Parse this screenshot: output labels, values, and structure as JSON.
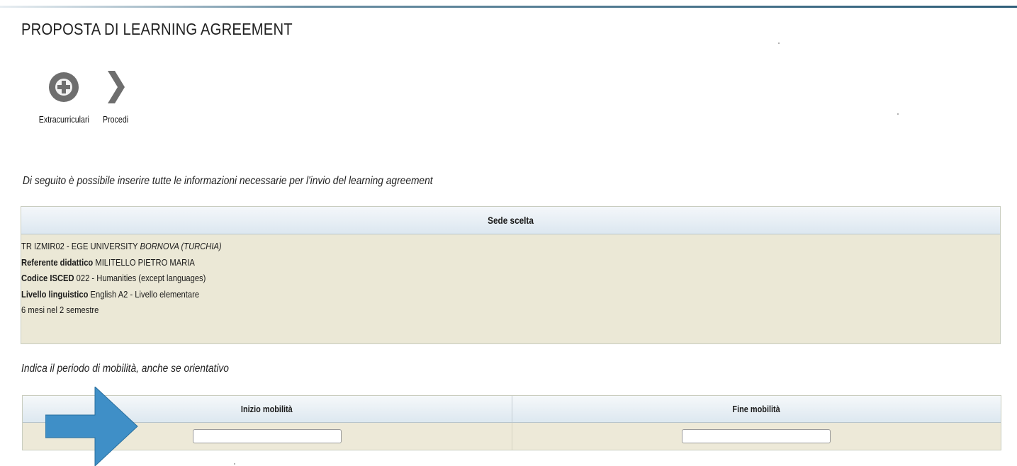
{
  "page": {
    "title": "PROPOSTA DI LEARNING AGREEMENT"
  },
  "toolbar": {
    "extracurricular_label": "Extracurriculari",
    "procedi_label": "Procedi"
  },
  "instructions": {
    "main": "Di seguito è possibile inserire tutte le informazioni necessarie per l'invio del learning agreement",
    "period": "Indica il periodo di mobilità, anche se orientativo"
  },
  "sede": {
    "header": "Sede scelta",
    "code_name": "TR IZMIR02 - EGE UNIVERSITY",
    "city_country": "BORNOVA (TURCHIA)",
    "referente_label": "Referente didattico",
    "referente_value": "MILITELLO PIETRO MARIA",
    "isced_label": "Codice ISCED",
    "isced_value": "022 - Humanities (except languages)",
    "livello_label": "Livello linguistico",
    "livello_value": "English A2 - Livello elementare",
    "durata": "6 mesi nel 2 semestre"
  },
  "mobility": {
    "start_header": "Inizio mobilità",
    "end_header": "Fine mobilità",
    "start_value": "",
    "end_value": ""
  },
  "colors": {
    "header_gradient_top": "#f4f7fa",
    "header_gradient_bottom": "#dce7f0",
    "row_background": "#ebe8d6",
    "icon_gray": "#6e6e6e",
    "arrow_blue": "#3f8fc7"
  }
}
